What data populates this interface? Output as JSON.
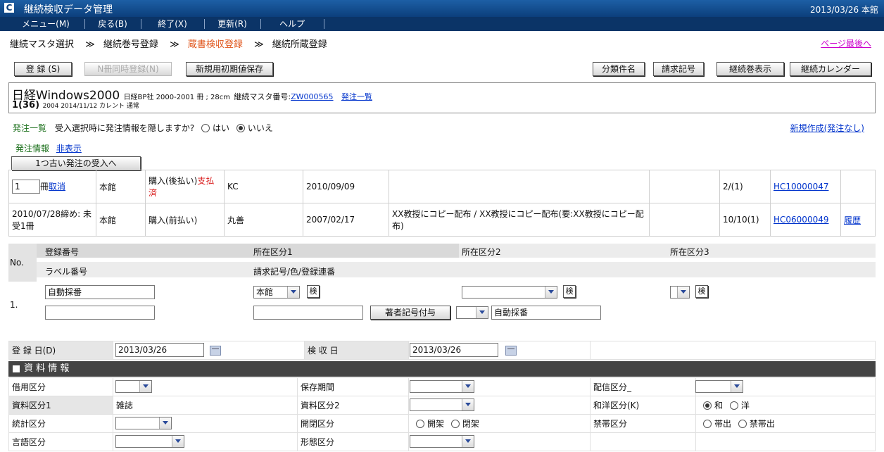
{
  "app": {
    "logo": "C",
    "title": "継続検収データ管理",
    "date_location": "2013/03/26 本館"
  },
  "menu": [
    {
      "label": "メニュー(M)"
    },
    {
      "label": "戻る(B)"
    },
    {
      "label": "終了(X)"
    },
    {
      "label": "更新(R)"
    },
    {
      "label": "ヘルプ"
    }
  ],
  "breadcrumb": {
    "items": [
      "継続マスタ選択",
      "継続巻号登録",
      "蔵書検収登録",
      "継続所蔵登録"
    ],
    "arrow": "≫",
    "page_bottom_link": "ページ最後へ"
  },
  "toolbar": {
    "register": "登 録 (S)",
    "n_register": "N冊同時登録(N)",
    "save_defaults": "新規用初期値保存",
    "category": "分類件名",
    "call_number": "請求記号",
    "volume_display": "継続巻表示",
    "calendar": "継続カレンダー"
  },
  "title_info": {
    "title": "日経Windows2000",
    "pub": "日経BP社 2000-2001 冊 ; 28cm",
    "master_label": "継続マスタ番号:",
    "master_no": "ZW000565",
    "order_list": "発注一覧",
    "vol": "1(36)",
    "detail": "2004 2014/11/12 カレント 通常"
  },
  "order_section": {
    "label": "発注一覧",
    "question": "受入選択時に発注情報を隠しますか?",
    "yes": "はい",
    "no": "いいえ",
    "selected": "no",
    "new_create": "新規作成(発注なし)",
    "info_label": "発注情報",
    "hide": "非表示",
    "older_button": "1つ古い発注の受入へ"
  },
  "orders": [
    {
      "qty": "1",
      "unit": "冊",
      "cancel": "取消",
      "location": "本館",
      "type": "購入(後払い)",
      "status": "支払済",
      "vendor": "KC",
      "date": "2010/09/09",
      "note": "",
      "count": "2/(1)",
      "code": "HC10000047",
      "history": ""
    },
    {
      "qty_text": "2010/07/28締め: 未受1冊",
      "location": "本館",
      "type": "購入(前払い)",
      "status": "",
      "vendor": "丸善",
      "date": "2007/02/17",
      "note": "XX教授にコピー配布 / XX教授にコピー配布(要:XX教授にコピー配布)",
      "count": "10/10(1)",
      "code": "HC06000049",
      "history": "履歴"
    }
  ],
  "registration": {
    "headers": {
      "no": "No.",
      "reg_no": "登録番号",
      "loc1": "所在区分1",
      "loc2": "所在区分2",
      "loc3": "所在区分3",
      "label_no": "ラベル番号",
      "callmark": "請求記号/色/登録連番"
    },
    "row": {
      "index": "1.",
      "reg_value": "自動採番",
      "loc1_value": "本館",
      "search": "検",
      "author_mark": "著者記号付与",
      "serial_value": "自動採番"
    }
  },
  "dates": {
    "reg_label": "登 録 日(D)",
    "reg_value": "2013/03/26",
    "insp_label": "検 収 日",
    "insp_value": "2013/03/26"
  },
  "material": {
    "section_title": "資 料 情 報",
    "credit": "借用区分",
    "retention": "保存期間",
    "delivery": "配信区分_",
    "type1": "資料区分1",
    "type1_value": "雑誌",
    "type2": "資料区分2",
    "lang_origin": "和洋区分(K)",
    "wa": "和",
    "you": "洋",
    "stats": "統計区分",
    "shelf": "開閉区分",
    "open": "開架",
    "closed": "閉架",
    "restriction": "禁帯区分",
    "lend": "帯出",
    "nolend": "禁帯出",
    "language": "言語区分",
    "form": "形態区分"
  }
}
